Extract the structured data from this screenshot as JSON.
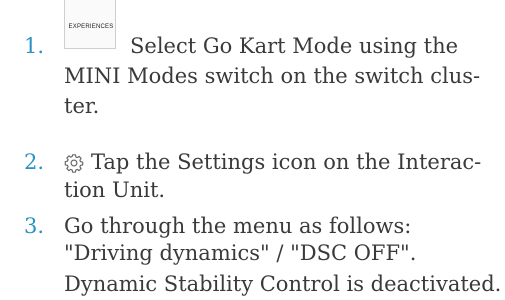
{
  "steps": [
    {
      "number": "1.",
      "button_label": "EXPERIENCES",
      "button_icon": "experiences-button-icon",
      "lines": [
        "Select Go Kart Mode using the",
        "MINI Modes switch on the switch clus-",
        "ter."
      ]
    },
    {
      "number": "2.",
      "icon": "settings-gear-icon",
      "lines": [
        "Tap the Settings icon on the Interac-",
        "tion Unit."
      ]
    },
    {
      "number": "3.",
      "lines": [
        "Go through the menu as follows:",
        "\"Driving dynamics\" / \"DSC OFF\"."
      ]
    }
  ],
  "result": "Dynamic Stability Control is deactivated.",
  "colors": {
    "step_number": "#2b93c3",
    "text": "#3a3a3a",
    "icon": "#6a6a6a"
  }
}
